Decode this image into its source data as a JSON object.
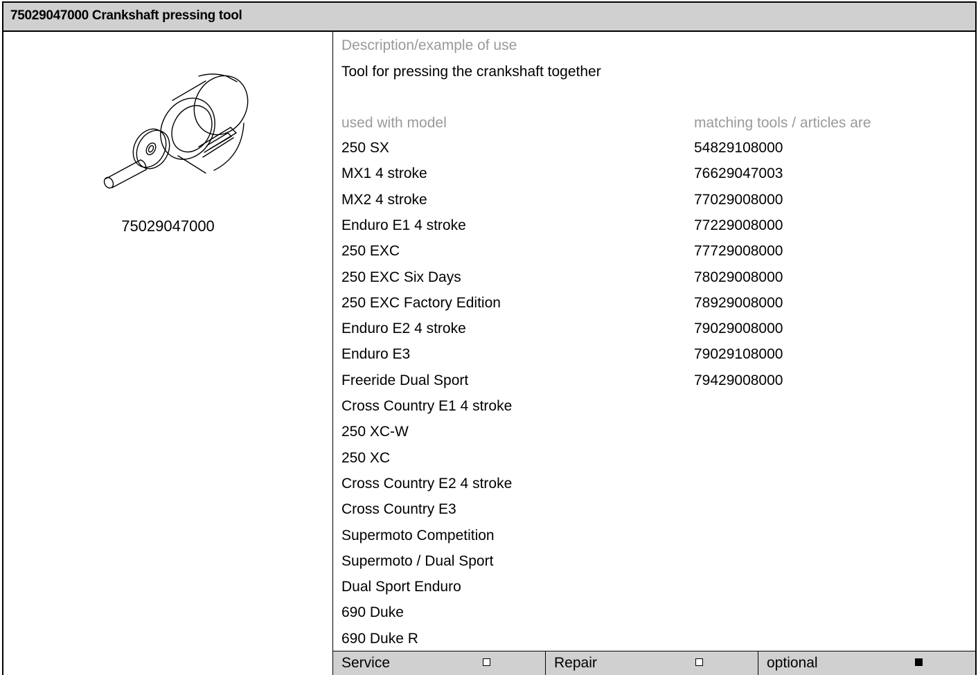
{
  "title": "75029047000 Crankshaft pressing tool",
  "tool": {
    "part_number": "75029047000",
    "figure_icon": "crankshaft-pressing-tool-icon"
  },
  "description": {
    "label": "Description/example of use",
    "text": "Tool for pressing the crankshaft together"
  },
  "models": {
    "label": "used with model",
    "items": [
      "250 SX",
      "MX1 4 stroke",
      "MX2 4 stroke",
      "Enduro E1 4 stroke",
      "250 EXC",
      "250 EXC Six Days",
      "250 EXC Factory Edition",
      "Enduro E2 4 stroke",
      "Enduro E3",
      "Freeride Dual Sport",
      "Cross Country E1 4 stroke",
      "250 XC-W",
      "250 XC",
      "Cross Country E2 4 stroke",
      "Cross Country E3",
      "Supermoto Competition",
      "Supermoto / Dual Sport",
      "Dual Sport Enduro",
      "690 Duke",
      "690 Duke R"
    ]
  },
  "matching": {
    "label": "matching tools / articles are",
    "items": [
      "54829108000",
      "76629047003",
      "77029008000",
      "77229008000",
      "77729008000",
      "78029008000",
      "78929008000",
      "79029008000",
      "79029108000",
      "79429008000"
    ]
  },
  "footer": {
    "service": {
      "label": "Service",
      "checked": false
    },
    "repair": {
      "label": "Repair",
      "checked": false
    },
    "optional": {
      "label": "optional",
      "checked": true
    }
  }
}
